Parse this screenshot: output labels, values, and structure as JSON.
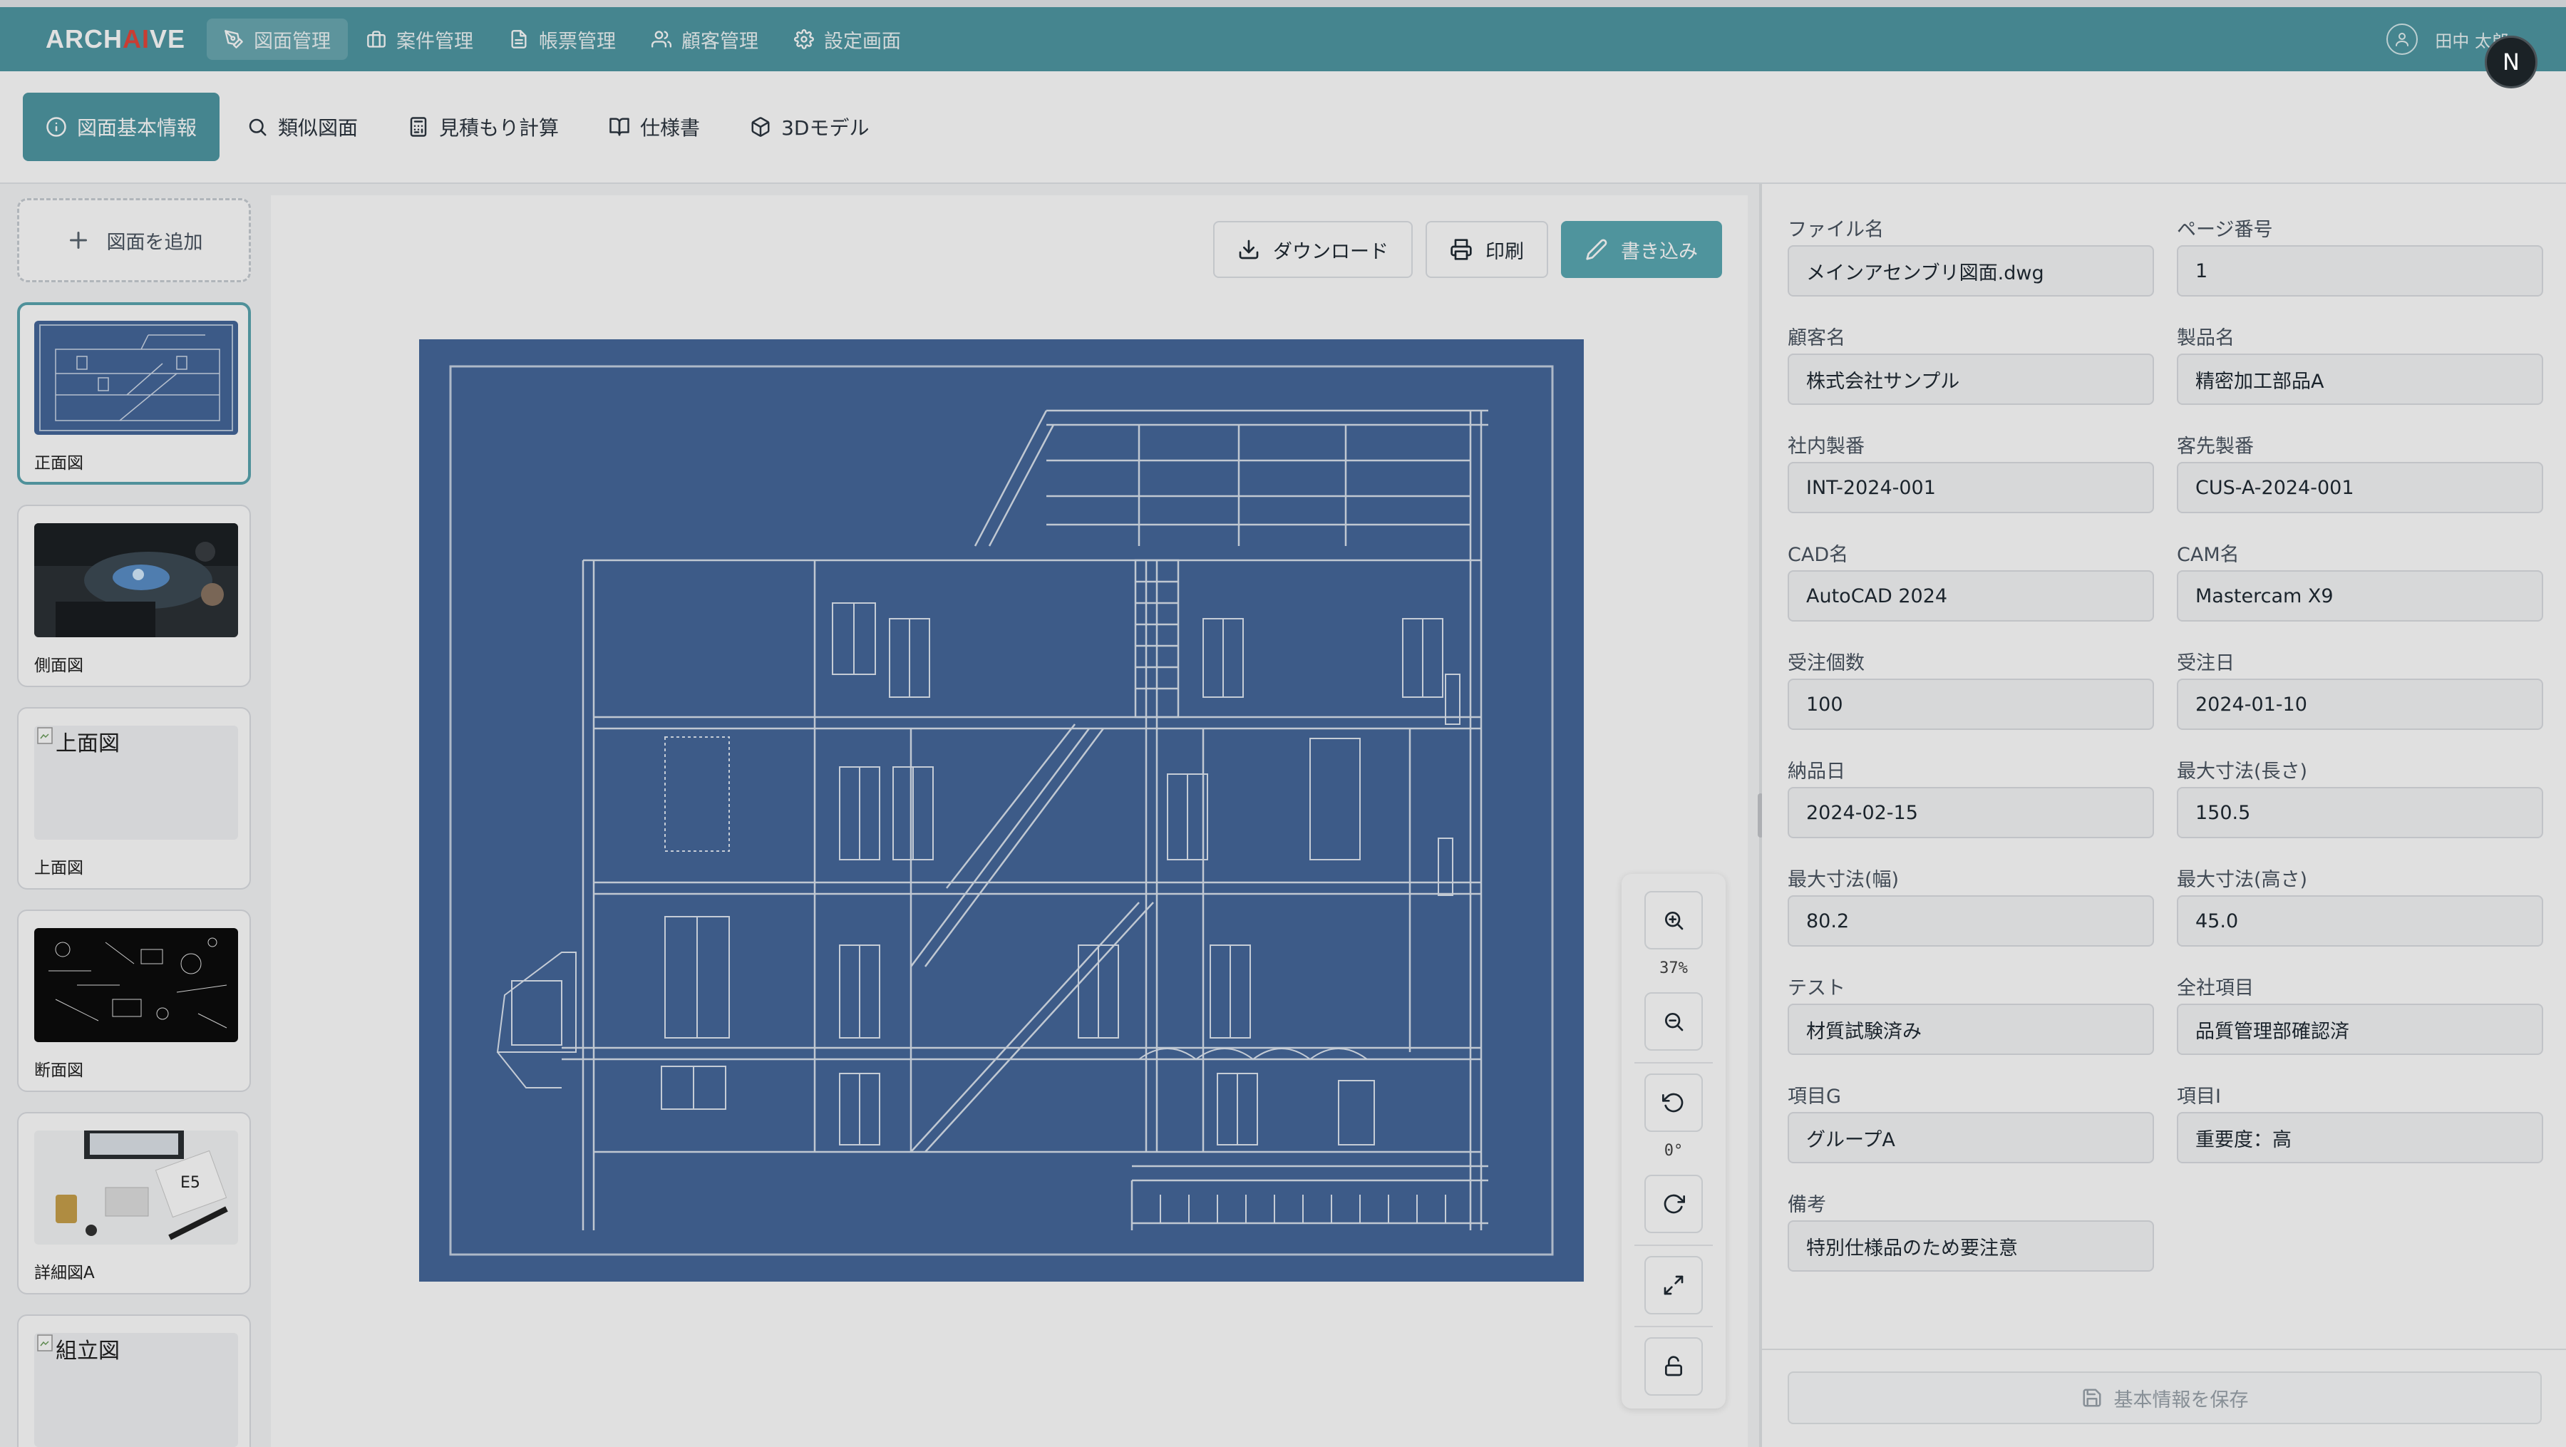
{
  "header": {
    "logo_prefix": "ARCH",
    "logo_ai": "AI",
    "logo_suffix": "VE",
    "nav": [
      {
        "label": "図面管理",
        "icon": "pen-tool-icon",
        "active": true
      },
      {
        "label": "案件管理",
        "icon": "briefcase-icon",
        "active": false
      },
      {
        "label": "帳票管理",
        "icon": "file-text-icon",
        "active": false
      },
      {
        "label": "顧客管理",
        "icon": "users-icon",
        "active": false
      },
      {
        "label": "設定画面",
        "icon": "gear-icon",
        "active": false
      }
    ],
    "user_name": "田中 太郎",
    "badge": "N"
  },
  "subnav": [
    {
      "label": "図面基本情報",
      "icon": "info-icon",
      "active": true
    },
    {
      "label": "類似図面",
      "icon": "search-icon",
      "active": false
    },
    {
      "label": "見積もり計算",
      "icon": "calculator-icon",
      "active": false
    },
    {
      "label": "仕様書",
      "icon": "book-icon",
      "active": false
    },
    {
      "label": "3Dモデル",
      "icon": "cube-icon",
      "active": false
    }
  ],
  "sidebar": {
    "add_label": "図面を追加",
    "thumbnails": [
      {
        "caption": "正面図",
        "alt": "",
        "selected": true
      },
      {
        "caption": "側面図",
        "alt": "",
        "selected": false
      },
      {
        "caption": "上面図",
        "alt": "上面図",
        "selected": false
      },
      {
        "caption": "断面図",
        "alt": "",
        "selected": false
      },
      {
        "caption": "詳細図A",
        "alt": "",
        "selected": false
      },
      {
        "caption": "",
        "alt": "組立図",
        "selected": false
      }
    ]
  },
  "viewer": {
    "download_label": "ダウンロード",
    "print_label": "印刷",
    "write_label": "書き込み",
    "zoom_level": "37%",
    "rotation": "0°"
  },
  "details": {
    "fields": [
      {
        "label": "ファイル名",
        "value": "メインアセンブリ図面.dwg"
      },
      {
        "label": "ページ番号",
        "value": "1"
      },
      {
        "label": "顧客名",
        "value": "株式会社サンプル"
      },
      {
        "label": "製品名",
        "value": "精密加工部品A"
      },
      {
        "label": "社内製番",
        "value": "INT-2024-001"
      },
      {
        "label": "客先製番",
        "value": "CUS-A-2024-001"
      },
      {
        "label": "CAD名",
        "value": "AutoCAD 2024"
      },
      {
        "label": "CAM名",
        "value": "Mastercam X9"
      },
      {
        "label": "受注個数",
        "value": "100"
      },
      {
        "label": "受注日",
        "value": "2024-01-10"
      },
      {
        "label": "納品日",
        "value": "2024-02-15"
      },
      {
        "label": "最大寸法(長さ)",
        "value": "150.5"
      },
      {
        "label": "最大寸法(幅)",
        "value": "80.2"
      },
      {
        "label": "最大寸法(高さ)",
        "value": "45.0"
      },
      {
        "label": "テスト",
        "value": "材質試験済み"
      },
      {
        "label": "全社項目",
        "value": "品質管理部確認済"
      },
      {
        "label": "項目G",
        "value": "グループA"
      },
      {
        "label": "項目I",
        "value": "重要度：高"
      },
      {
        "label": "備考",
        "value": "特別仕様品のため要注意"
      }
    ],
    "save_label": "基本情報を保存"
  },
  "colors": {
    "header_bg": "#4f98a3",
    "accent": "#5aa9b3",
    "logo_ai": "#e4463b",
    "blueprint": "#45679a"
  }
}
